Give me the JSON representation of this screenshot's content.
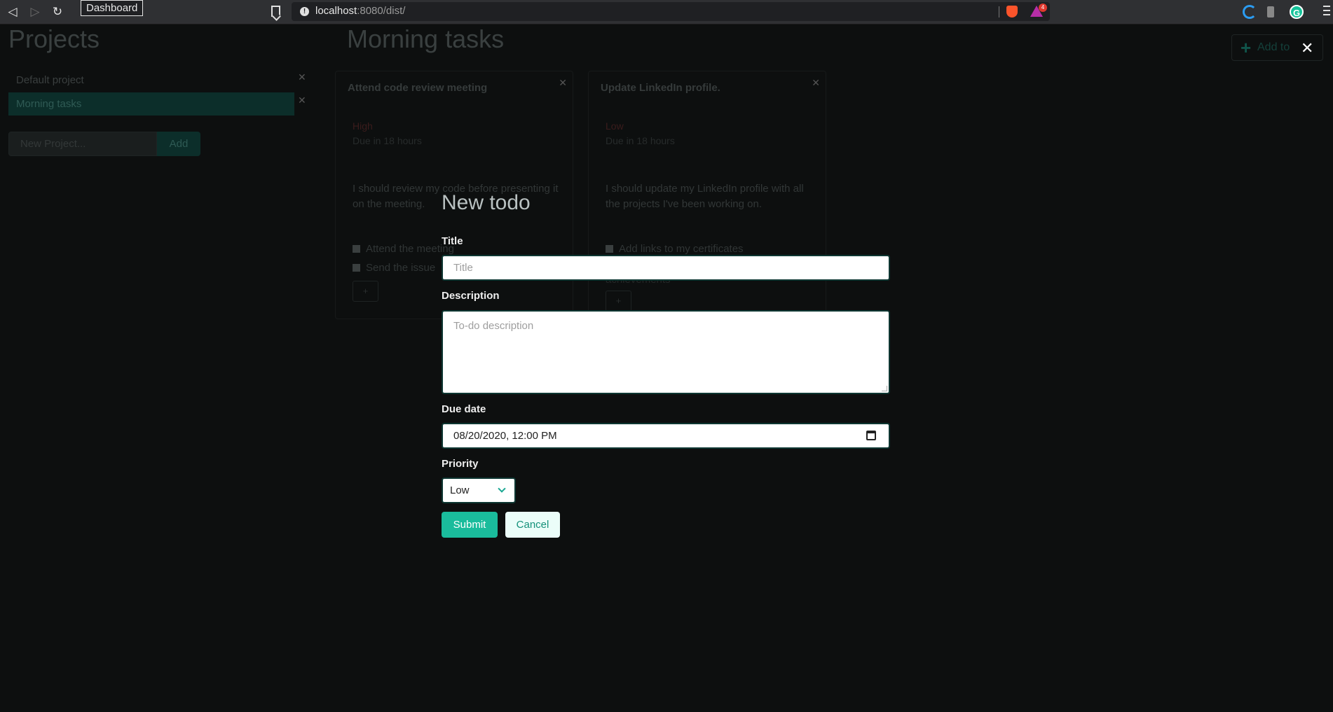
{
  "browser": {
    "tab_tooltip": "Dashboard",
    "url_host": "localhost",
    "url_rest": ":8080/dist/",
    "rewards_badge": "4"
  },
  "sidebar": {
    "title": "Projects",
    "projects": [
      {
        "label": "Default project",
        "active": false
      },
      {
        "label": "Morning tasks",
        "active": true
      }
    ],
    "new_project_placeholder": "New Project...",
    "add_label": "Add"
  },
  "main": {
    "title": "Morning tasks",
    "add_todo_label": "Add to",
    "cards": [
      {
        "title": "Attend code review meeting",
        "priority": "High",
        "due": "Due in 18 hours",
        "description": "I should review my code before presenting it on the meeting.",
        "checklist": [
          "Attend the meeting",
          "Send the issue"
        ]
      },
      {
        "title": "Update LinkedIn profile.",
        "priority": "Low",
        "due": "Due in 18 hours",
        "description": "I should update my LinkedIn profile with all the projects I've been working on.",
        "checklist": [
          "Add links to my certificates",
          "achievements"
        ]
      }
    ]
  },
  "modal": {
    "title": "New todo",
    "title_label": "Title",
    "title_placeholder": "Title",
    "description_label": "Description",
    "description_placeholder": "To-do description",
    "due_label": "Due date",
    "due_value": "08/20/2020, 12:00 PM",
    "priority_label": "Priority",
    "priority_value": "Low",
    "submit_label": "Submit",
    "cancel_label": "Cancel"
  },
  "colors": {
    "accent": "#1abc9c",
    "background": "#0d0f0f"
  }
}
